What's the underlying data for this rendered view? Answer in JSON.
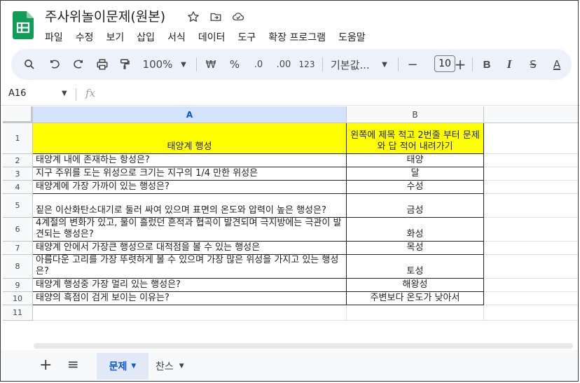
{
  "app": {
    "title": "주사위놀이문제(원본)",
    "icons": [
      "star-icon",
      "move-folder-icon",
      "cloud-status-icon"
    ],
    "brand_color": "#0f9d58"
  },
  "menu": [
    "파일",
    "수정",
    "보기",
    "삽입",
    "서식",
    "데이터",
    "도구",
    "확장 프로그램",
    "도움말"
  ],
  "toolbar": {
    "zoom": "100%",
    "currency": "₩",
    "percent": "%",
    "decimal_decrease": ".0",
    "decimal_increase": ".00",
    "number_format": "123",
    "font": "기본값...",
    "font_size": "10",
    "minus": "−",
    "plus": "+",
    "bold": "B",
    "italic": "I",
    "strike": "S",
    "text_color": "A"
  },
  "formula_bar": {
    "cell_ref": "A16",
    "fx": "fx",
    "value": ""
  },
  "columns": [
    "A",
    "B"
  ],
  "rows": [
    {
      "num": "1",
      "a": "태양계 행성",
      "b": "왼쪽에 제목 적고 2번줄 부터 문제와 답 적어 내려가기"
    },
    {
      "num": "2",
      "a": "태양계 내에 존재하는 항성은?",
      "b": "태양"
    },
    {
      "num": "3",
      "a": "지구 주위를 도는 위성으로 크기는 지구의 1/4 만한 위성은",
      "b": "달"
    },
    {
      "num": "4",
      "a": "태양계에 가장 가까이 있는 행성은?",
      "b": "수성"
    },
    {
      "num": "5",
      "a": "짙은 이산화탄소대기로 둘러 싸여 있으며 표면의 온도와 압력이 높은 행성은?",
      "b": "금성"
    },
    {
      "num": "6",
      "a": "4계절의 변화가 있고, 물이 흘렀던 흔적과 협곡이 발견되며 극지방에는 극관이 발견되는 행성은?",
      "b": "화성"
    },
    {
      "num": "7",
      "a": "태양계 안에서 가장큰 행성으로 대적점을 볼 수 있는 행성은",
      "b": "목성"
    },
    {
      "num": "8",
      "a": "아름다운 고리를 가장 뚜렷하게 볼 수 있으며 가장 많은 위성을 가지고 있는 행성은?",
      "b": "토성"
    },
    {
      "num": "9",
      "a": "태양계 행성중 가장 멀리 있는 행성은?",
      "b": "해왕성"
    },
    {
      "num": "10",
      "a": "태양의 흑점이 검게 보이는 이유는?",
      "b": "주변보다 온도가 낮아서"
    },
    {
      "num": "11",
      "a": "",
      "b": ""
    }
  ],
  "sheets": {
    "add": "+",
    "all": "≡",
    "tabs": [
      {
        "label": "문제",
        "active": true
      },
      {
        "label": "찬스",
        "active": false
      }
    ]
  },
  "colors": {
    "header_fill": "#ffff00",
    "active_tab": "#0b57d0",
    "toolbar_bg": "#edf2fa"
  }
}
